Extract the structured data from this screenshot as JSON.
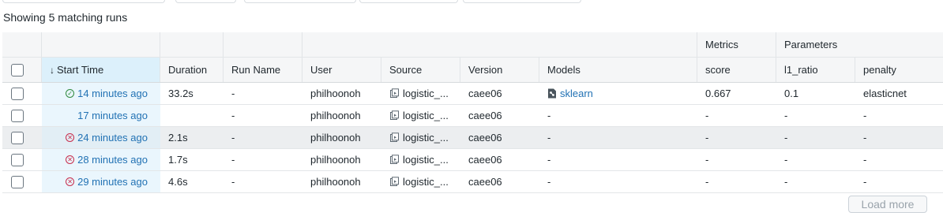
{
  "summary": "Showing 5 matching runs",
  "header_groups": {
    "metrics": "Metrics",
    "parameters": "Parameters"
  },
  "columns": {
    "start_time": "Start Time",
    "duration": "Duration",
    "run_name": "Run Name",
    "user": "User",
    "source": "Source",
    "version": "Version",
    "models": "Models",
    "score": "score",
    "l1_ratio": "l1_ratio",
    "penalty": "penalty"
  },
  "sort_indicator": "↓",
  "runs": [
    {
      "status": "finished",
      "start_time": "14 minutes ago",
      "duration": "33.2s",
      "run_name": "-",
      "user": "philhoonoh",
      "source": "logistic_...",
      "version": "caee06",
      "models": "sklearn",
      "score": "0.667",
      "l1_ratio": "0.1",
      "penalty": "elasticnet"
    },
    {
      "status": "running",
      "start_time": "17 minutes ago",
      "duration": "",
      "run_name": "-",
      "user": "philhoonoh",
      "source": "logistic_...",
      "version": "caee06",
      "models": "-",
      "score": "-",
      "l1_ratio": "-",
      "penalty": "-"
    },
    {
      "status": "failed",
      "start_time": "24 minutes ago",
      "duration": "2.1s",
      "run_name": "-",
      "user": "philhoonoh",
      "source": "logistic_...",
      "version": "caee06",
      "models": "-",
      "score": "-",
      "l1_ratio": "-",
      "penalty": "-"
    },
    {
      "status": "failed",
      "start_time": "28 minutes ago",
      "duration": "1.7s",
      "run_name": "-",
      "user": "philhoonoh",
      "source": "logistic_...",
      "version": "caee06",
      "models": "-",
      "score": "-",
      "l1_ratio": "-",
      "penalty": "-"
    },
    {
      "status": "failed",
      "start_time": "29 minutes ago",
      "duration": "4.6s",
      "run_name": "-",
      "user": "philhoonoh",
      "source": "logistic_...",
      "version": "caee06",
      "models": "-",
      "score": "-",
      "l1_ratio": "-",
      "penalty": "-"
    }
  ],
  "load_more": "Load more",
  "colors": {
    "link": "#2272b4",
    "success": "#2f8a3e",
    "failure": "#c82d4c",
    "sorted_header_bg": "#dcf0fb"
  }
}
